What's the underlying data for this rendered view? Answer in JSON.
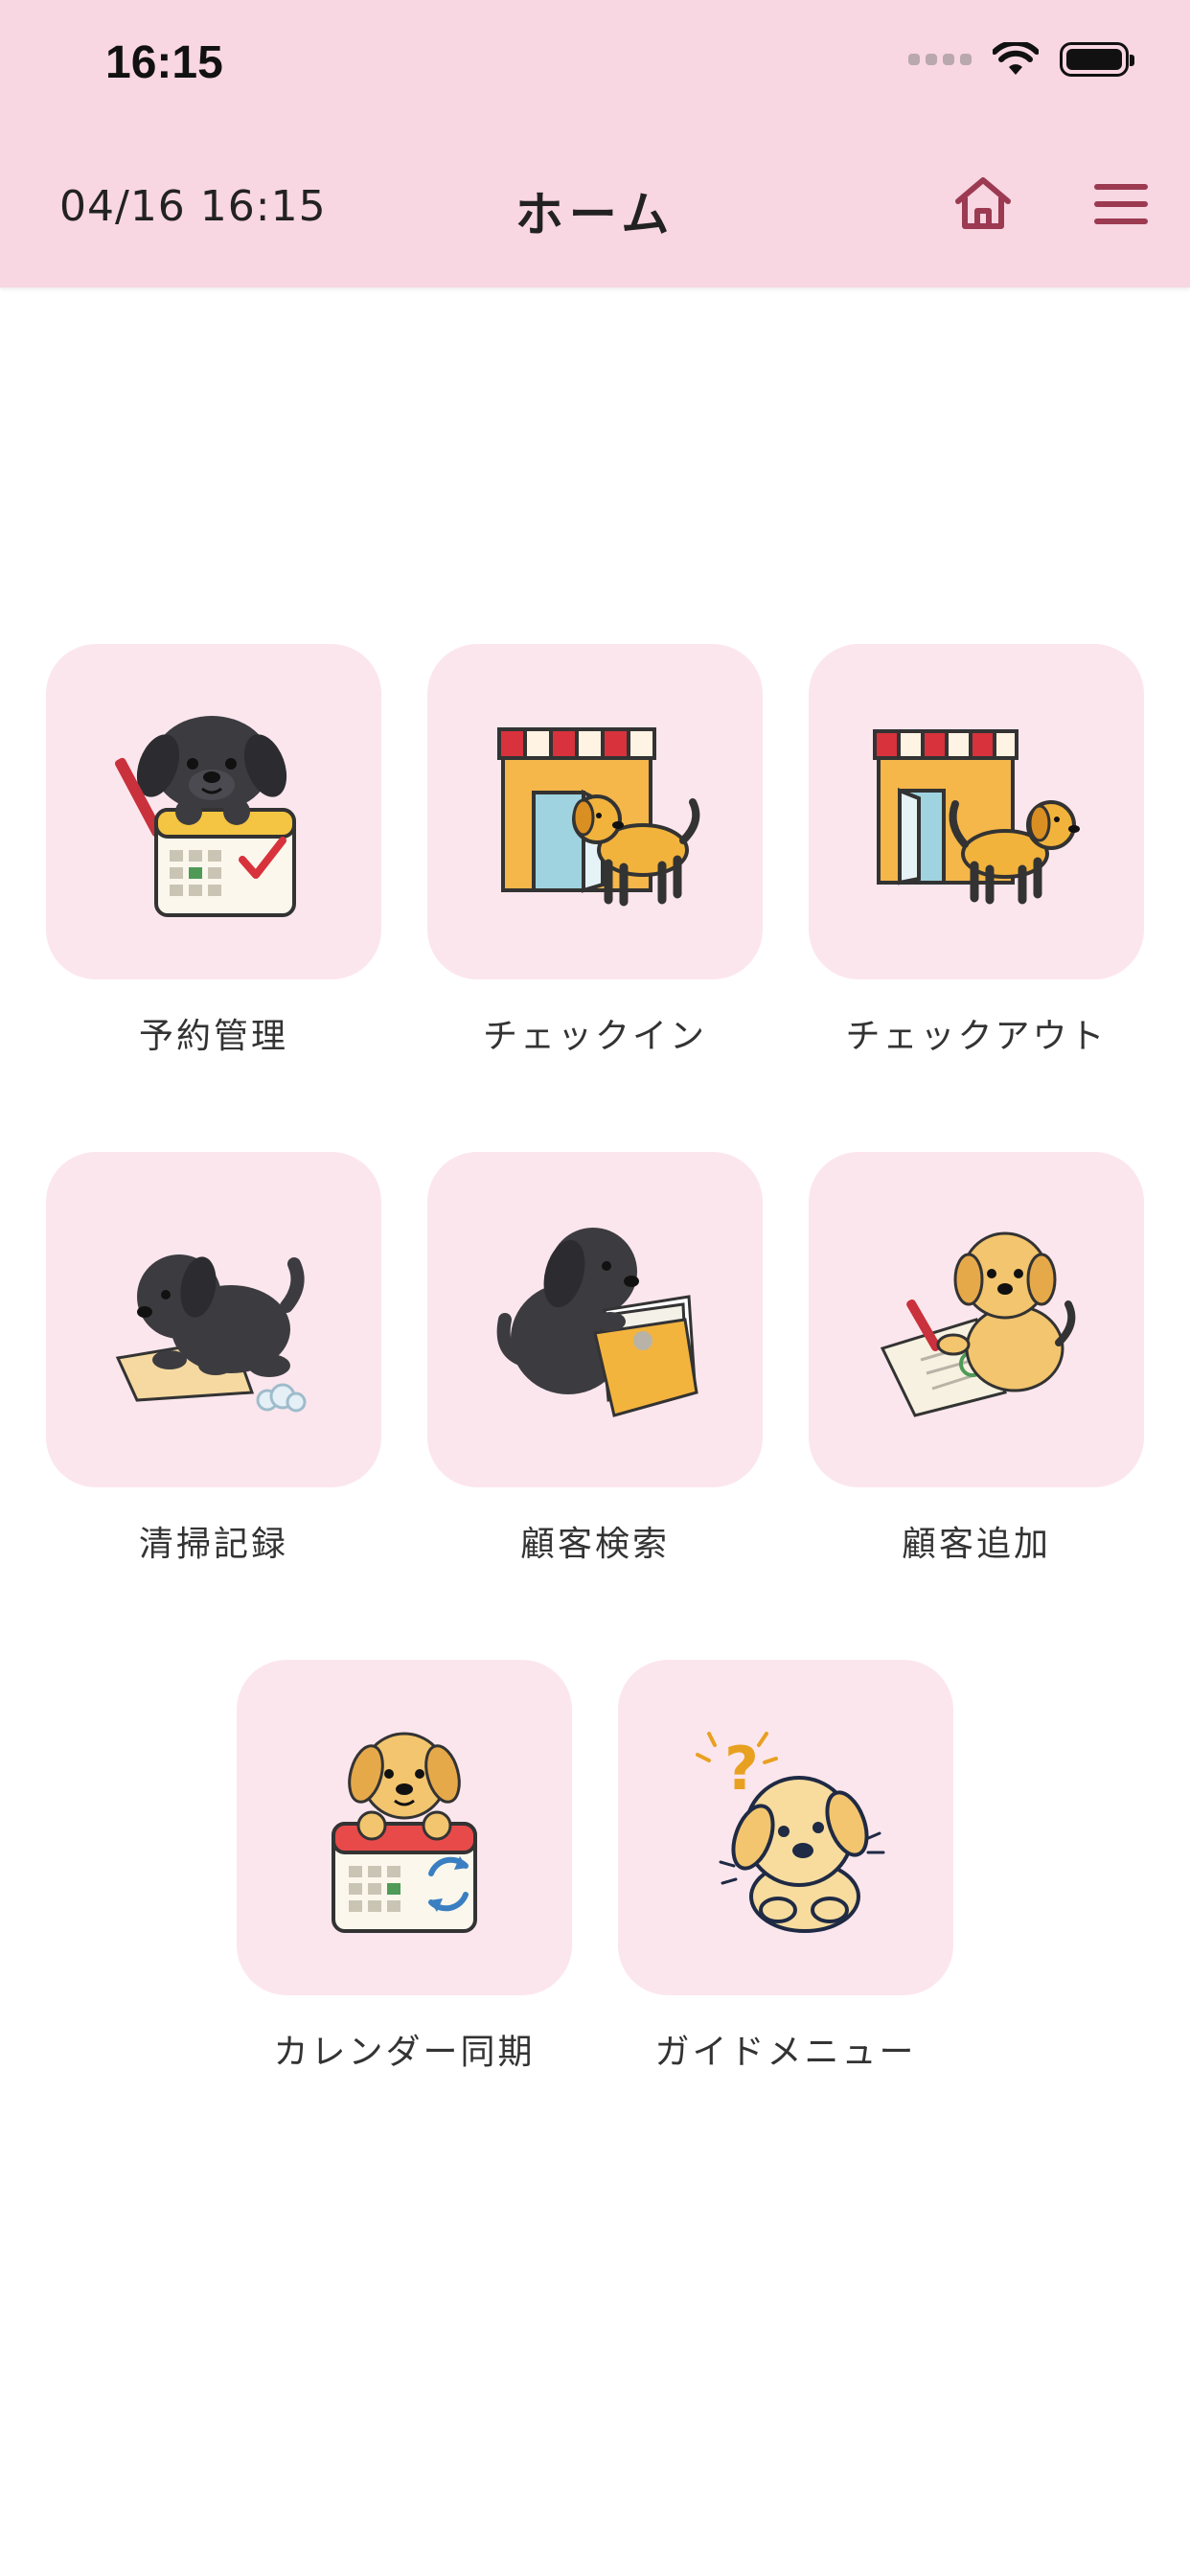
{
  "status_bar": {
    "time": "16:15"
  },
  "header": {
    "datetime": "04/16 16:15",
    "title": "ホーム",
    "home_icon": "home-icon",
    "menu_icon": "hamburger-menu-icon",
    "accent_color": "#9c3a52",
    "background_color": "#f8d6e2"
  },
  "menu": {
    "tile_background": "#fce6ed",
    "items": [
      {
        "label": "予約管理",
        "icon": "black-puppy-calendar-icon"
      },
      {
        "label": "チェックイン",
        "icon": "shop-dog-entering-icon"
      },
      {
        "label": "チェックアウト",
        "icon": "shop-dog-leaving-icon"
      },
      {
        "label": "清掃記録",
        "icon": "black-puppy-cleaning-icon"
      },
      {
        "label": "顧客検索",
        "icon": "black-puppy-folder-icon"
      },
      {
        "label": "顧客追加",
        "icon": "golden-puppy-form-icon"
      },
      {
        "label": "カレンダー同期",
        "icon": "golden-puppy-calendar-sync-icon"
      },
      {
        "label": "ガイドメニュー",
        "icon": "golden-puppy-question-icon"
      }
    ]
  }
}
